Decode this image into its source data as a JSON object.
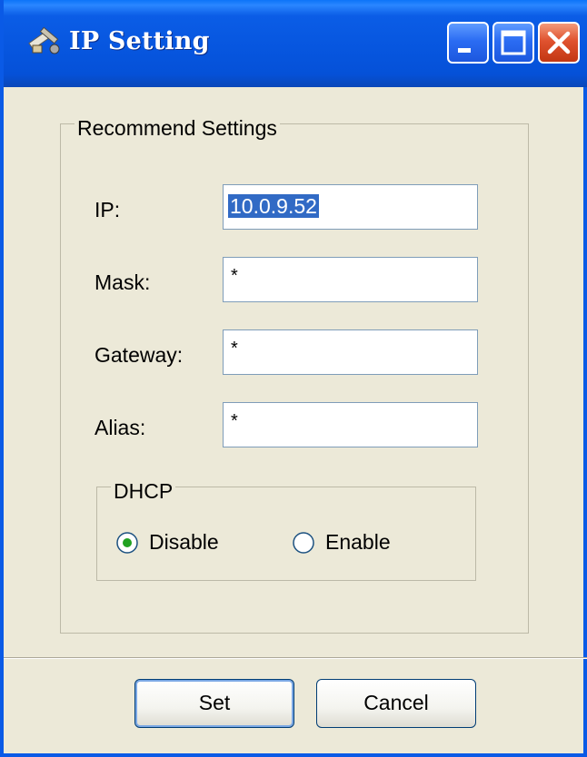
{
  "window": {
    "title": "IP Setting",
    "icon": "tools-icon",
    "controls": {
      "minimize": "minimize-icon",
      "maximize": "maximize-icon",
      "close": "close-icon"
    }
  },
  "group": {
    "label": "Recommend Settings",
    "fields": [
      {
        "label": "IP:",
        "value": "10.0.9.52",
        "selected": true
      },
      {
        "label": "Mask:",
        "value": "*"
      },
      {
        "label": "Gateway:",
        "value": "*"
      },
      {
        "label": "Alias:",
        "value": "*"
      }
    ]
  },
  "dhcp": {
    "label": "DHCP",
    "options": [
      {
        "label": "Disable",
        "checked": true
      },
      {
        "label": "Enable",
        "checked": false
      }
    ]
  },
  "buttons": {
    "set": "Set",
    "cancel": "Cancel"
  },
  "colors": {
    "titlebar": "#0756df",
    "dialog_bg": "#ece9d8",
    "selection": "#316ac5",
    "radio_dot": "#21a121"
  }
}
